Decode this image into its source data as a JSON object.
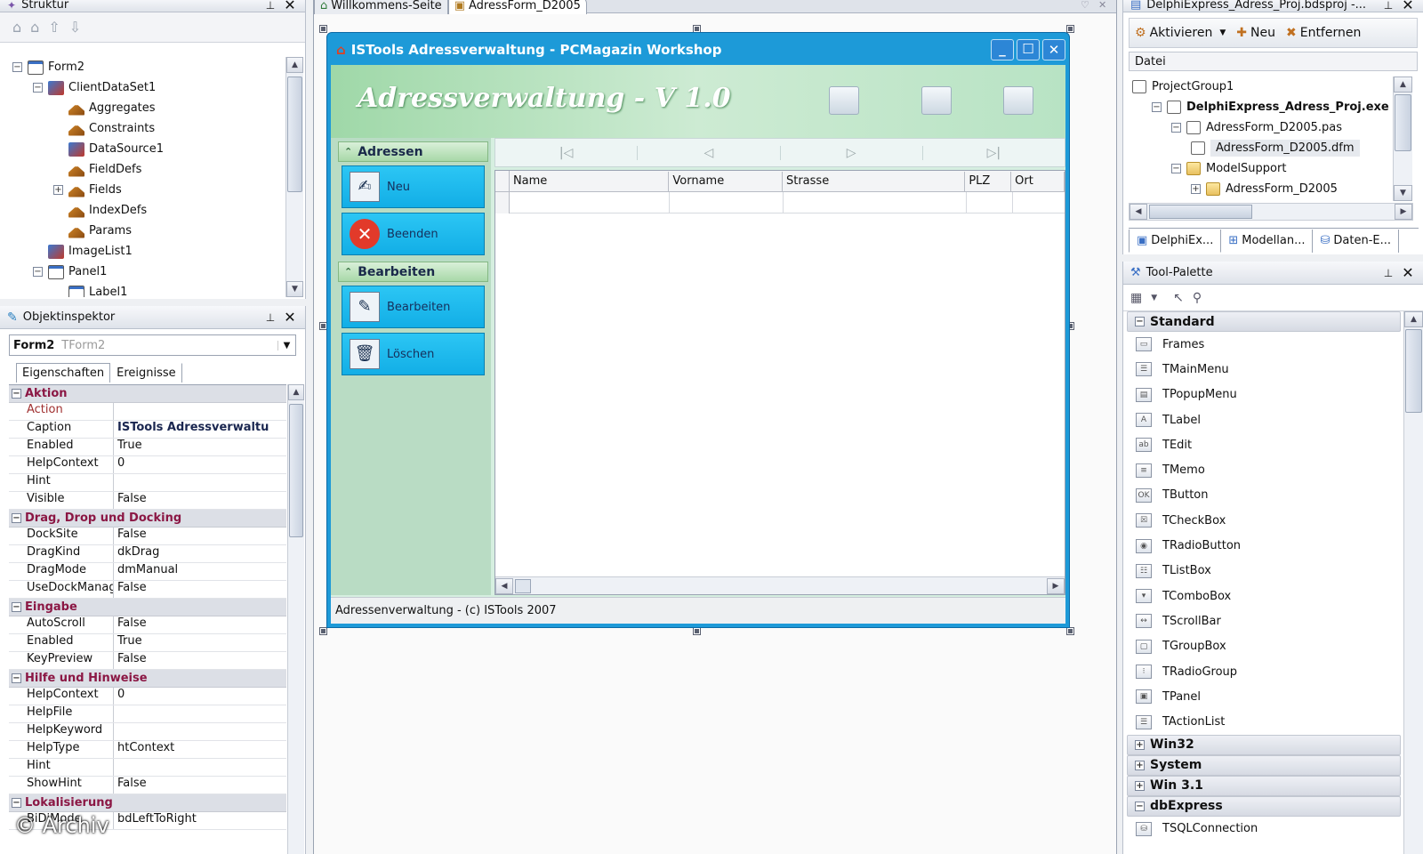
{
  "structure": {
    "title": "Struktur",
    "tree": [
      {
        "label": "Form2",
        "indent": 0,
        "expander": "−",
        "icon": "frm"
      },
      {
        "label": "ClientDataSet1",
        "indent": 1,
        "expander": "−",
        "icon": "ds"
      },
      {
        "label": "Aggregates",
        "indent": 2,
        "expander": "",
        "icon": "cmp"
      },
      {
        "label": "Constraints",
        "indent": 2,
        "expander": "",
        "icon": "cmp"
      },
      {
        "label": "DataSource1",
        "indent": 2,
        "expander": "",
        "icon": "ds"
      },
      {
        "label": "FieldDefs",
        "indent": 2,
        "expander": "",
        "icon": "cmp"
      },
      {
        "label": "Fields",
        "indent": 2,
        "expander": "+",
        "icon": "cmp"
      },
      {
        "label": "IndexDefs",
        "indent": 2,
        "expander": "",
        "icon": "cmp"
      },
      {
        "label": "Params",
        "indent": 2,
        "expander": "",
        "icon": "cmp"
      },
      {
        "label": "ImageList1",
        "indent": 1,
        "expander": "",
        "icon": "ds"
      },
      {
        "label": "Panel1",
        "indent": 1,
        "expander": "−",
        "icon": "frm"
      },
      {
        "label": "Label1",
        "indent": 2,
        "expander": "",
        "icon": "frm"
      }
    ]
  },
  "inspector": {
    "title": "Objektinspektor",
    "object_name": "Form2",
    "object_type": "TForm2",
    "tabs": [
      "Eigenschaften",
      "Ereignisse"
    ],
    "rows": [
      {
        "cat": "Aktion"
      },
      {
        "k": "Action",
        "v": "",
        "red": true
      },
      {
        "k": "Caption",
        "v": "ISTools Adressverwaltu",
        "bold": true
      },
      {
        "k": "Enabled",
        "v": "True"
      },
      {
        "k": "HelpContext",
        "v": "0"
      },
      {
        "k": "Hint",
        "v": ""
      },
      {
        "k": "Visible",
        "v": "False"
      },
      {
        "cat": "Drag, Drop und Docking"
      },
      {
        "k": "DockSite",
        "v": "False"
      },
      {
        "k": "DragKind",
        "v": "dkDrag"
      },
      {
        "k": "DragMode",
        "v": "dmManual"
      },
      {
        "k": "UseDockManager",
        "v": "False"
      },
      {
        "cat": "Eingabe"
      },
      {
        "k": "AutoScroll",
        "v": "False"
      },
      {
        "k": "Enabled",
        "v": "True"
      },
      {
        "k": "KeyPreview",
        "v": "False"
      },
      {
        "cat": "Hilfe und Hinweise"
      },
      {
        "k": "HelpContext",
        "v": "0"
      },
      {
        "k": "HelpFile",
        "v": ""
      },
      {
        "k": "HelpKeyword",
        "v": ""
      },
      {
        "k": "HelpType",
        "v": "htContext"
      },
      {
        "k": "Hint",
        "v": ""
      },
      {
        "k": "ShowHint",
        "v": "False"
      },
      {
        "cat": "Lokalisierung"
      },
      {
        "k": "BiDiMode",
        "v": "bdLeftToRight"
      }
    ],
    "watermark": "© Archiv"
  },
  "editor_tabs": [
    "Willkommens-Seite",
    "AdressForm_D2005"
  ],
  "form": {
    "caption": "ISTools Adressverwaltung - PCMagazin Workshop",
    "banner_title": "Adressverwaltung - V 1.0",
    "sections": [
      {
        "header": "Adressen",
        "buttons": [
          "Neu",
          "Beenden"
        ]
      },
      {
        "header": "Bearbeiten",
        "buttons": [
          "Bearbeiten",
          "Löschen"
        ]
      }
    ],
    "nav_glyphs": [
      "|◁",
      "◁",
      "▷",
      "▷|"
    ],
    "columns": [
      "Name",
      "Vorname",
      "Strasse",
      "PLZ",
      "Ort"
    ],
    "status": "Adressenverwaltung - (c) ISTools 2007"
  },
  "project": {
    "title": "DelphiExpress_Adress_Proj.bdsproj -...",
    "toolbar": [
      "Aktivieren",
      "Neu",
      "Entfernen"
    ],
    "column_header": "Datei",
    "tree": [
      {
        "label": "ProjectGroup1",
        "indent": 0,
        "bold": false,
        "selected": false
      },
      {
        "label": "DelphiExpress_Adress_Proj.exe",
        "indent": 1,
        "bold": true,
        "selected": false
      },
      {
        "label": "AdressForm_D2005.pas",
        "indent": 2,
        "bold": false,
        "selected": false
      },
      {
        "label": "AdressForm_D2005.dfm",
        "indent": 3,
        "bold": false,
        "selected": true
      },
      {
        "label": "ModelSupport",
        "indent": 2,
        "bold": false,
        "selected": false
      },
      {
        "label": "AdressForm_D2005",
        "indent": 3,
        "bold": false,
        "selected": false
      }
    ],
    "bottom_tabs": [
      "DelphiEx...",
      "Modellan...",
      "Daten-E..."
    ]
  },
  "palette": {
    "title": "Tool-Palette",
    "categories": [
      {
        "name": "Standard",
        "expanded": true,
        "items": [
          "Frames",
          "TMainMenu",
          "TPopupMenu",
          "TLabel",
          "TEdit",
          "TMemo",
          "TButton",
          "TCheckBox",
          "TRadioButton",
          "TListBox",
          "TComboBox",
          "TScrollBar",
          "TGroupBox",
          "TRadioGroup",
          "TPanel",
          "TActionList"
        ]
      },
      {
        "name": "Win32",
        "expanded": false,
        "items": []
      },
      {
        "name": "System",
        "expanded": false,
        "items": []
      },
      {
        "name": "Win 3.1",
        "expanded": false,
        "items": []
      },
      {
        "name": "dbExpress",
        "expanded": true,
        "items": [
          "TSQLConnection"
        ]
      }
    ]
  }
}
